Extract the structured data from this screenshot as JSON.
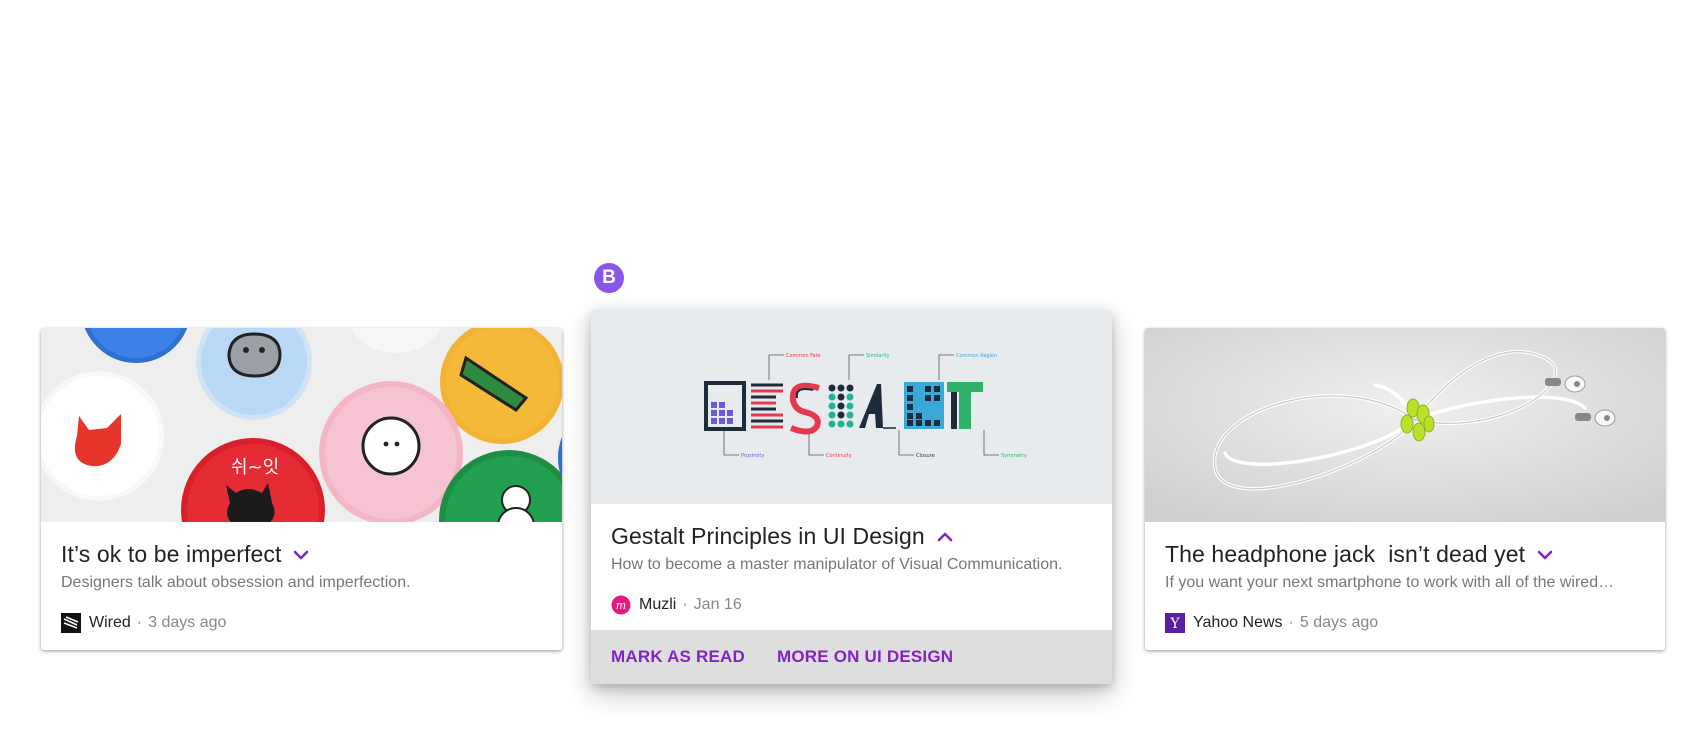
{
  "badge": {
    "label": "B",
    "color": "#8b55ec"
  },
  "accent_color": "#8224c4",
  "cards": [
    {
      "title": "It’s ok to be imperfect",
      "description": "Designers talk about obsession and imperfection.",
      "source": "Wired",
      "time": "3 days ago",
      "expand_icon": "chevron-down-icon",
      "source_icon": "wired-logo-icon",
      "image": "colorful-pin-buttons-image"
    },
    {
      "title": "Gestalt Principles in UI Design",
      "description": "How to become a master manipulator of Visual Communication.",
      "source": "Muzli",
      "time": "Jan 16",
      "expand_icon": "chevron-up-icon",
      "source_icon": "muzli-logo-icon",
      "image": "gestalt-typography-image",
      "gestalt": {
        "word": "GESTALT",
        "labels_top": [
          "Common Fate",
          "Similarity",
          "Common Region"
        ],
        "labels_bottom": [
          "Proximity",
          "Continuity",
          "Closure",
          "Symmetry"
        ]
      },
      "actions": [
        "MARK AS READ",
        "MORE ON UI DESIGN"
      ]
    },
    {
      "title": "The headphone jack  isn’t dead yet",
      "description": "If you want your next smartphone to work with all of the wired…",
      "source": "Yahoo News",
      "time": "5 days ago",
      "expand_icon": "chevron-down-icon",
      "source_icon": "yahoo-logo-icon",
      "image": "tangled-earbuds-image"
    }
  ]
}
